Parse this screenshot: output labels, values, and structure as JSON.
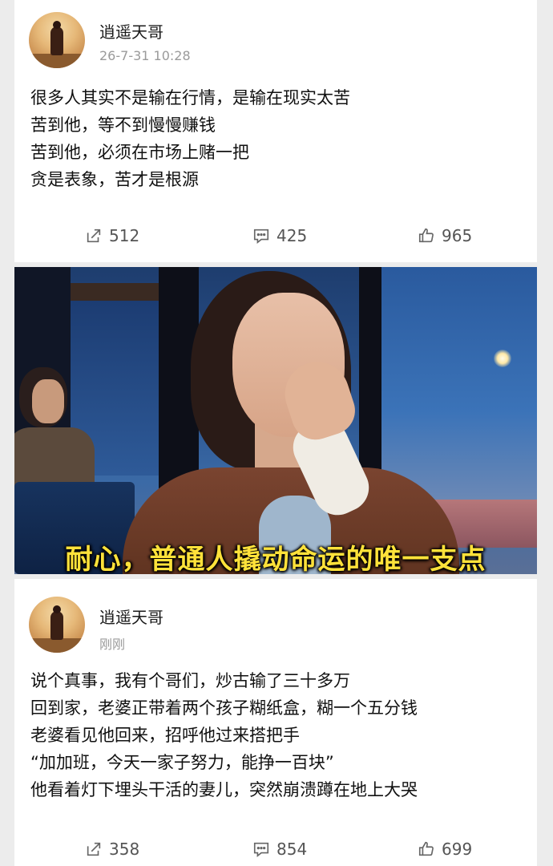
{
  "posts": [
    {
      "username": "逍遥天哥",
      "time": "26-7-31 10:28",
      "lines": [
        "很多人其实不是输在行情，是输在现实太苦",
        "苦到他，等不到慢慢赚钱",
        "苦到他，必须在市场上赌一把",
        "贪是表象，苦才是根源"
      ],
      "shares": "512",
      "comments": "425",
      "likes": "965"
    },
    {
      "username": "逍遥天哥",
      "time": "刚刚",
      "lines": [
        "说个真事，我有个哥们，炒古输了三十多万",
        "回到家，老婆正带着两个孩子糊纸盒，糊一个五分钱",
        "老婆看见他回来，招呼他过来搭把手",
        "“加加班，今天一家子努力，能挣一百块”",
        "他看着灯下埋头干活的妻儿，突然崩溃蹲在地上大哭"
      ],
      "shares": "358",
      "comments": "854",
      "likes": "699"
    }
  ],
  "hero": {
    "caption": "耐心，普通人撬动命运的唯一支点"
  },
  "icons": {
    "share": "share-icon",
    "comment": "comment-icon",
    "like": "thumbs-up-icon"
  },
  "colors": {
    "caption": "#ffe23a",
    "background": "#ececec"
  }
}
